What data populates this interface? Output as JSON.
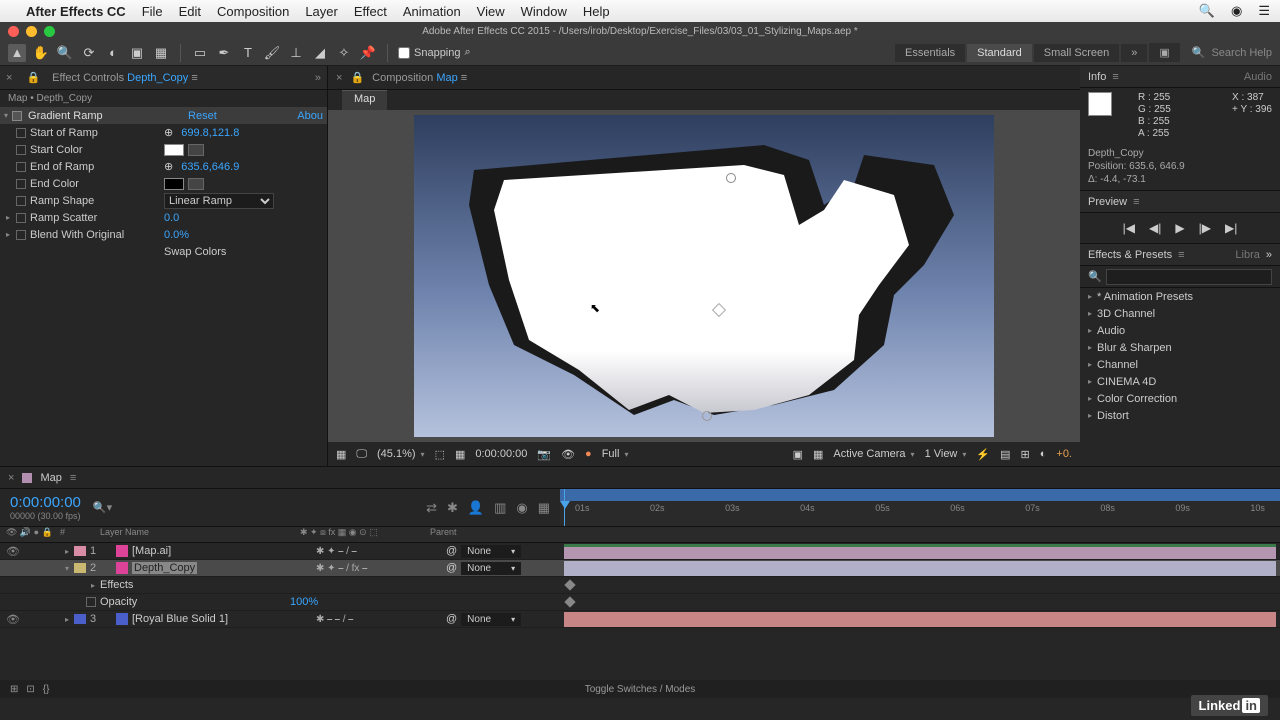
{
  "menubar": {
    "app": "After Effects CC",
    "items": [
      "File",
      "Edit",
      "Composition",
      "Layer",
      "Effect",
      "Animation",
      "View",
      "Window",
      "Help"
    ]
  },
  "title": "Adobe After Effects CC 2015 - /Users/irob/Desktop/Exercise_Files/03/03_01_Stylizing_Maps.aep *",
  "toolbar": {
    "snapping": "Snapping"
  },
  "workspaces": {
    "items": [
      "Essentials",
      "Standard",
      "Small Screen"
    ],
    "active": 1,
    "search_ph": "Search Help"
  },
  "effect_controls": {
    "tab_prefix": "Effect Controls ",
    "tab_layer": "Depth_Copy",
    "crumb": "Map • Depth_Copy",
    "fx_name": "Gradient Ramp",
    "reset": "Reset",
    "about": "Abou",
    "props": {
      "start_ramp": {
        "lbl": "Start of Ramp",
        "val": "699.8,121.8"
      },
      "start_color": {
        "lbl": "Start Color"
      },
      "end_ramp": {
        "lbl": "End of Ramp",
        "val": "635.6,646.9"
      },
      "end_color": {
        "lbl": "End Color"
      },
      "ramp_shape": {
        "lbl": "Ramp Shape",
        "val": "Linear Ramp"
      },
      "ramp_scatter": {
        "lbl": "Ramp Scatter",
        "val": "0.0"
      },
      "blend": {
        "lbl": "Blend With Original",
        "val": "0.0%"
      },
      "swap": "Swap Colors"
    }
  },
  "composition": {
    "tab_prefix": "Composition ",
    "tab_name": "Map",
    "subtab": "Map"
  },
  "viewer": {
    "zoom": "(45.1%)",
    "time": "0:00:00:00",
    "res": "Full",
    "camera": "Active Camera",
    "views": "1 View",
    "exp": "+0."
  },
  "info": {
    "header": "Info",
    "audio": "Audio",
    "r": "R : 255",
    "g": "G : 255",
    "b": "B : 255",
    "a": "A : 255",
    "x": "X : 387",
    "y": "Y : 396",
    "layer": "Depth_Copy",
    "pos": "Position: 635.6, 646.9",
    "delta": "Δ: -4.4, -73.1"
  },
  "preview": {
    "header": "Preview"
  },
  "effects_presets": {
    "header": "Effects & Presets",
    "lib": "Libra",
    "items": [
      "* Animation Presets",
      "3D Channel",
      "Audio",
      "Blur & Sharpen",
      "Channel",
      "CINEMA 4D",
      "Color Correction",
      "Distort"
    ]
  },
  "timeline": {
    "tab": "Map",
    "timecode": "0:00:00:00",
    "fps": "00000 (30.00 fps)",
    "cols": {
      "num": "#",
      "name": "Layer Name",
      "parent": "Parent"
    },
    "ticks": [
      "01s",
      "02s",
      "03s",
      "04s",
      "05s",
      "06s",
      "07s",
      "08s",
      "09s",
      "10s"
    ],
    "layers": [
      {
        "n": "1",
        "name": "[Map.ai]",
        "parent": "None",
        "tag": "pink"
      },
      {
        "n": "2",
        "name": "Depth_Copy",
        "parent": "None",
        "tag": "yel",
        "sel": true,
        "subs": [
          {
            "lbl": "Effects"
          },
          {
            "lbl": "Opacity",
            "val": "100%"
          }
        ]
      },
      {
        "n": "3",
        "name": "[Royal Blue Solid 1]",
        "parent": "None",
        "tag": "blue"
      }
    ],
    "footer": "Toggle Switches / Modes"
  },
  "brand": "Linked"
}
